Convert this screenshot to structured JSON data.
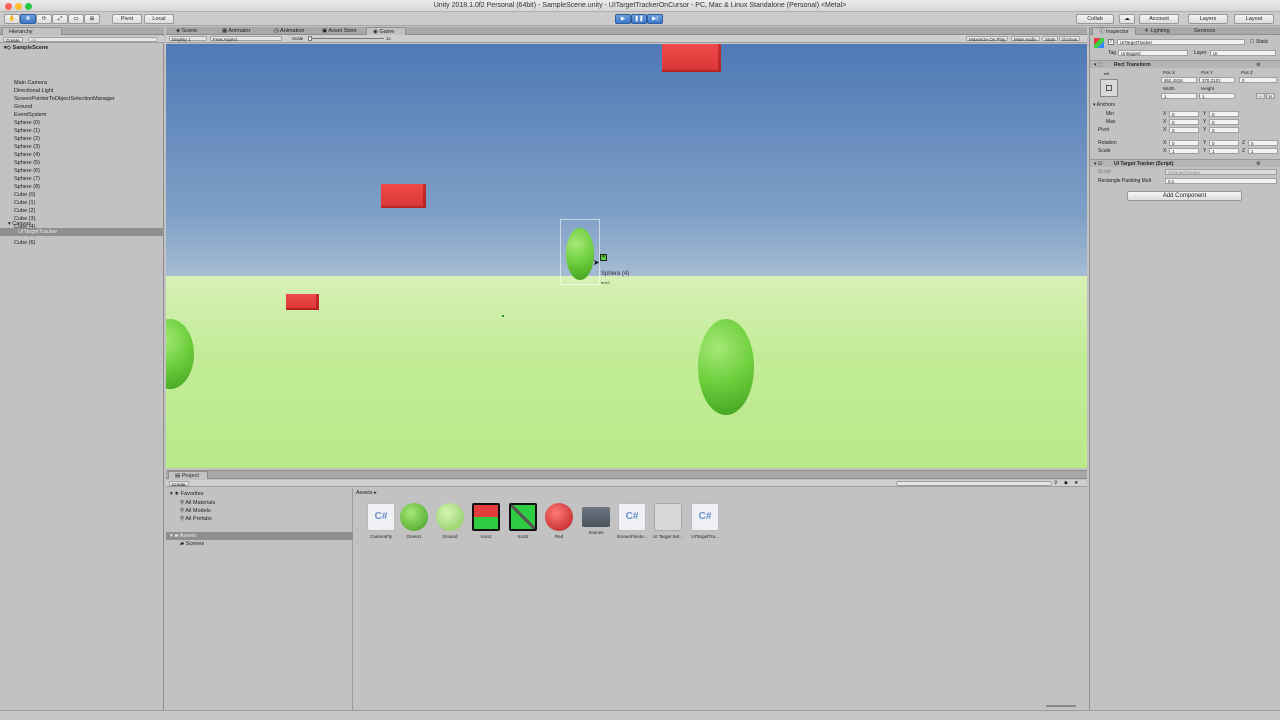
{
  "window": {
    "title": "Unity 2018.1.0f2 Personal (64bit) - SampleScene.unity - UITargetTrackerOnCursor - PC, Mac & Linux Standalone (Personal) <Metal>"
  },
  "toolbar": {
    "pivot": "Pivot",
    "local": "Local",
    "collab": "Collab",
    "account": "Account",
    "layers": "Layers",
    "layout": "Layout"
  },
  "hierarchy": {
    "tab": "Hierarchy",
    "create": "Create",
    "search_placeholder": "All",
    "scene": "SampleScene",
    "items": [
      "Main Camera",
      "Directional Light",
      "ScreenPointerToObjectSelectionManager",
      "Ground",
      "EventSystem",
      "Sphere (0)",
      "Sphere (1)",
      "Sphere (2)",
      "Sphere (3)",
      "Sphere (4)",
      "Sphere (5)",
      "Sphere (6)",
      "Sphere (7)",
      "Sphere (8)",
      "Cube (0)",
      "Cube (1)",
      "Cube (2)",
      "Cube (3)",
      "Cube (4)",
      "Cube (5)",
      "Cube (6)"
    ],
    "canvas": "Canvas",
    "selected_child": "UITargetTracker"
  },
  "center_tabs": {
    "scene": "Scene",
    "animator": "Animator",
    "animation": "Animation",
    "asset_store": "Asset Store",
    "game": "Game"
  },
  "game_bar": {
    "display": "Display 1",
    "aspect": "Free Aspect",
    "scale_label": "Scale",
    "scale_value": "1x",
    "maximize": "Maximize On Play",
    "mute": "Mute Audio",
    "stats": "Stats",
    "gizmos": "Gizmos"
  },
  "game_view": {
    "tracker_label": "Sphere (4)",
    "tracker_sub": "text2"
  },
  "right_tabs": {
    "inspector": "Inspector",
    "lighting": "Lighting",
    "services": "Services"
  },
  "inspector": {
    "object_name": "UITargetTracker",
    "static": "Static",
    "tag_label": "Tag",
    "tag_value": "Untagged",
    "layer_label": "Layer",
    "layer_value": "UI",
    "rect_transform": "Rect Transform",
    "left_label": "left",
    "pos_x_label": "Pos X",
    "pos_y_label": "Pos Y",
    "pos_z_label": "Pos Z",
    "pos_x": "862.4816",
    "pos_y": "376.2101",
    "pos_z": "0",
    "width_label": "Width",
    "height_label": "Height",
    "width": "1",
    "height": "1",
    "anchors": "Anchors",
    "min": "Min",
    "max": "Max",
    "pivot": "Pivot",
    "min_x": "0",
    "min_y": "0",
    "max_x": "0",
    "max_y": "0",
    "pivot_x": "0",
    "pivot_y": "0",
    "rotation": "Rotation",
    "rot_x": "0",
    "rot_y": "0",
    "rot_z": "0",
    "scale": "Scale",
    "scale_x": "1",
    "scale_y": "1",
    "scale_z": "1",
    "script_component": "UI Target Tracker (Script)",
    "script_label": "Script",
    "script_value": "UITargetTracker",
    "padding_label": "Rectangle Padding Mult",
    "padding_value": "0.1",
    "add_component": "Add Component",
    "x": "X",
    "y": "Y",
    "z": "Z",
    "r": "R"
  },
  "project": {
    "tab": "Project",
    "create": "Create",
    "favorites": "Favorites",
    "fav_items": [
      "All Materials",
      "All Models",
      "All Prefabs"
    ],
    "assets": "Assets",
    "scenes_folder": "Scenes",
    "breadcrumb": "Assets",
    "items": [
      {
        "label": "CameraFly",
        "icon": "csharp-script-icon"
      },
      {
        "label": "Green1",
        "icon": "green-material-icon"
      },
      {
        "label": "Ground",
        "icon": "ground-material-icon"
      },
      {
        "label": "Icon1",
        "icon": "icon1-sprite-icon"
      },
      {
        "label": "Icon2",
        "icon": "icon2-sprite-icon"
      },
      {
        "label": "Red",
        "icon": "red-material-icon"
      },
      {
        "label": "Scenes",
        "icon": "folder-icon"
      },
      {
        "label": "ScreenPointe...",
        "icon": "csharp-script-icon"
      },
      {
        "label": "UI Target Set...",
        "icon": "prefab-icon"
      },
      {
        "label": "UITargetTra...",
        "icon": "csharp-script-icon"
      }
    ]
  },
  "colors": {
    "selection": "#8f8f8f",
    "accent": "#3d79c8",
    "red_cube": "#e23b3b",
    "green_sphere": "#6fd03d"
  }
}
